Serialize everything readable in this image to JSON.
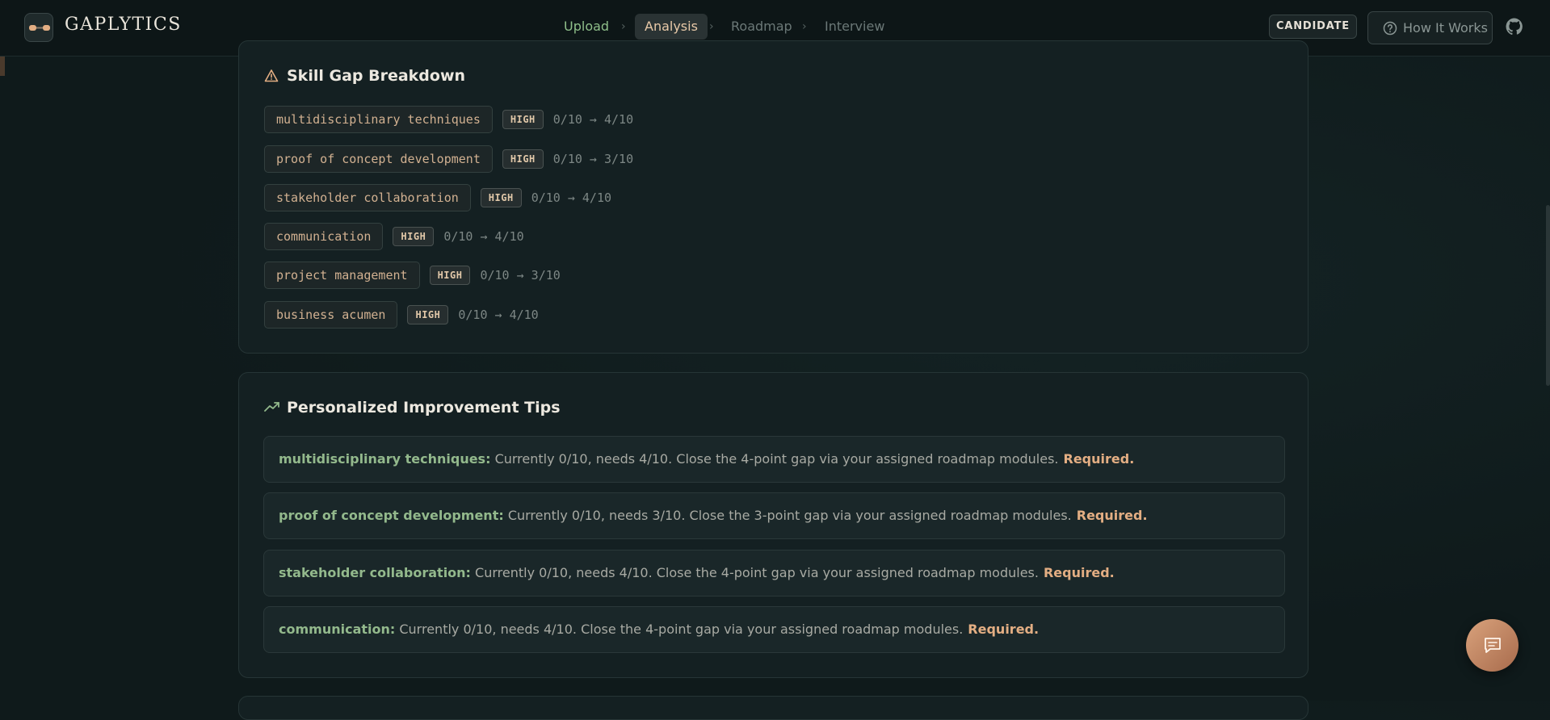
{
  "header": {
    "brand": "GAPLYTICS",
    "steps": [
      {
        "label": "Upload",
        "state": "done"
      },
      {
        "label": "Analysis",
        "state": "active"
      },
      {
        "label": "Roadmap",
        "state": "todo"
      },
      {
        "label": "Interview",
        "state": "todo"
      }
    ],
    "role_badge": "CANDIDATE",
    "how_it_works": "How It Works",
    "icons": {
      "help": "question-circle-icon",
      "github": "github-icon",
      "logo": "glasses-icon"
    }
  },
  "gap_section": {
    "title": "Skill Gap Breakdown",
    "icon": "warning-triangle-icon",
    "items": [
      {
        "skill": "multidisciplinary techniques",
        "severity": "HIGH",
        "range": "0/10 → 4/10"
      },
      {
        "skill": "proof of concept development",
        "severity": "HIGH",
        "range": "0/10 → 3/10"
      },
      {
        "skill": "stakeholder collaboration",
        "severity": "HIGH",
        "range": "0/10 → 4/10"
      },
      {
        "skill": "communication",
        "severity": "HIGH",
        "range": "0/10 → 4/10"
      },
      {
        "skill": "project management",
        "severity": "HIGH",
        "range": "0/10 → 3/10"
      },
      {
        "skill": "business acumen",
        "severity": "HIGH",
        "range": "0/10 → 4/10"
      }
    ]
  },
  "tips_section": {
    "title": "Personalized Improvement Tips",
    "icon": "trending-up-icon",
    "items": [
      {
        "skill": "multidisciplinary techniques:",
        "text": " Currently 0/10, needs 4/10. Close the 4-point gap via your assigned roadmap modules.",
        "tag": "Required."
      },
      {
        "skill": "proof of concept development:",
        "text": " Currently 0/10, needs 3/10. Close the 3-point gap via your assigned roadmap modules.",
        "tag": "Required."
      },
      {
        "skill": "stakeholder collaboration:",
        "text": " Currently 0/10, needs 4/10. Close the 4-point gap via your assigned roadmap modules.",
        "tag": "Required."
      },
      {
        "skill": "communication:",
        "text": " Currently 0/10, needs 4/10. Close the 4-point gap via your assigned roadmap modules.",
        "tag": "Required."
      }
    ]
  },
  "chat_button": {
    "icon": "chat-message-icon"
  },
  "colors": {
    "accent": "#e3ae83",
    "success": "#93b98c",
    "background": "#0f1a1b",
    "card": "#142022"
  }
}
